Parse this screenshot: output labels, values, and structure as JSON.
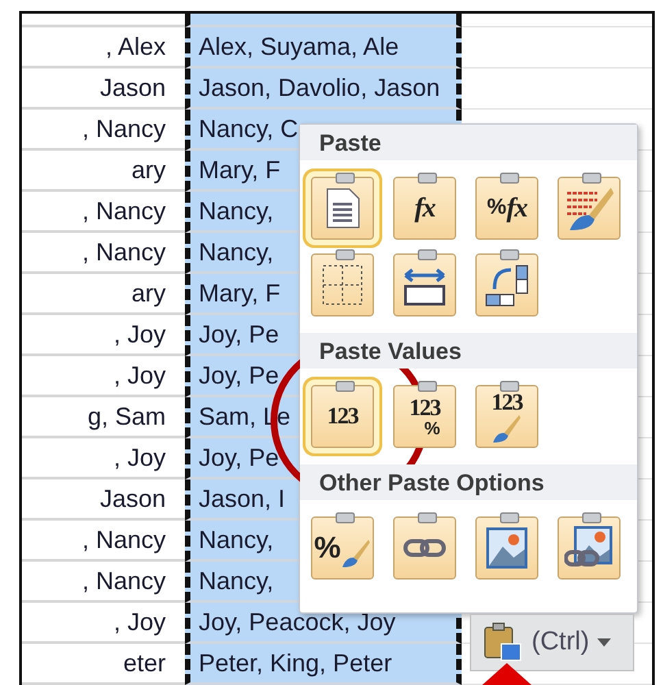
{
  "sheet": {
    "rows": [
      {
        "a": ", Alex",
        "b": "Alex, Suyama, Ale"
      },
      {
        "a": "Jason",
        "b": "Jason, Davolio, Jason"
      },
      {
        "a": ", Nancy",
        "b": "Nancy, C"
      },
      {
        "a": "ary",
        "b": "Mary, F"
      },
      {
        "a": ", Nancy",
        "b": "Nancy,"
      },
      {
        "a": ", Nancy",
        "b": "Nancy,"
      },
      {
        "a": "ary",
        "b": "Mary, F"
      },
      {
        "a": ", Joy",
        "b": "Joy, Pe"
      },
      {
        "a": ", Joy",
        "b": "Joy, Pe"
      },
      {
        "a": "g, Sam",
        "b": "Sam, Le"
      },
      {
        "a": ", Joy",
        "b": "Joy, Pe"
      },
      {
        "a": "Jason",
        "b": "Jason, I"
      },
      {
        "a": ", Nancy",
        "b": "Nancy,"
      },
      {
        "a": ", Nancy",
        "b": "Nancy,"
      },
      {
        "a": ", Joy",
        "b": "Joy, Peacock, Joy"
      },
      {
        "a": "eter",
        "b": "Peter, King, Peter"
      }
    ]
  },
  "paste_menu": {
    "sections": [
      {
        "title": "Paste",
        "options": [
          {
            "kind": "paste",
            "highlighted": true
          },
          {
            "kind": "formulas",
            "highlighted": false,
            "text": "fx"
          },
          {
            "kind": "formulas-number",
            "highlighted": false,
            "text": "fx",
            "mark": "%"
          },
          {
            "kind": "keep-source",
            "highlighted": false
          },
          {
            "kind": "no-borders",
            "highlighted": false
          },
          {
            "kind": "column-widths",
            "highlighted": false
          },
          {
            "kind": "transpose",
            "highlighted": false
          }
        ]
      },
      {
        "title": "Paste Values",
        "options": [
          {
            "kind": "values",
            "highlighted": true,
            "text": "123"
          },
          {
            "kind": "values-number",
            "highlighted": false,
            "text": "123",
            "mark": "%"
          },
          {
            "kind": "values-source",
            "highlighted": false,
            "text": "123"
          }
        ]
      },
      {
        "title": "Other Paste Options",
        "options": [
          {
            "kind": "formatting",
            "highlighted": false,
            "mark": "%"
          },
          {
            "kind": "link",
            "highlighted": false
          },
          {
            "kind": "picture",
            "highlighted": false
          },
          {
            "kind": "linked-picture",
            "highlighted": false
          }
        ]
      }
    ]
  },
  "options_button": {
    "label": "(Ctrl)"
  }
}
